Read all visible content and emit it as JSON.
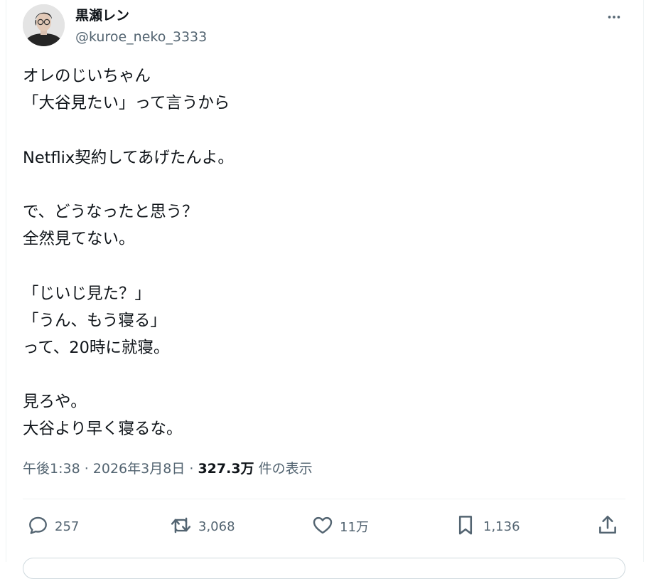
{
  "author": {
    "name": "黒瀬レン",
    "handle": "@kuroe_neko_3333"
  },
  "tweet": {
    "lines": [
      "オレのじいちゃん",
      "「大谷見たい」って言うから",
      "",
      "Netflix契約してあげたんよ。",
      "",
      "で、どうなったと思う？",
      "全然見てない。",
      "",
      "「じいじ見た？」",
      "「うん、もう寝る」",
      "って、20時に就寝。",
      "",
      "見ろや。",
      "大谷より早く寝るな。"
    ]
  },
  "meta": {
    "time": "午後1:38",
    "sep1": " · ",
    "date": "2026年3月8日",
    "sep2": " · ",
    "views": "327.3万",
    "views_suffix": " 件の表示"
  },
  "actions": {
    "reply_count": "257",
    "retweet_count": "3,068",
    "like_count": "11万",
    "bookmark_count": "1,136"
  },
  "icons": {
    "more": "more-icon",
    "reply": "reply-icon",
    "retweet": "retweet-icon",
    "like": "heart-icon",
    "bookmark": "bookmark-icon",
    "share": "share-icon"
  },
  "colors": {
    "text": "#0f1419",
    "muted": "#536471",
    "divider": "#eff3f4"
  }
}
